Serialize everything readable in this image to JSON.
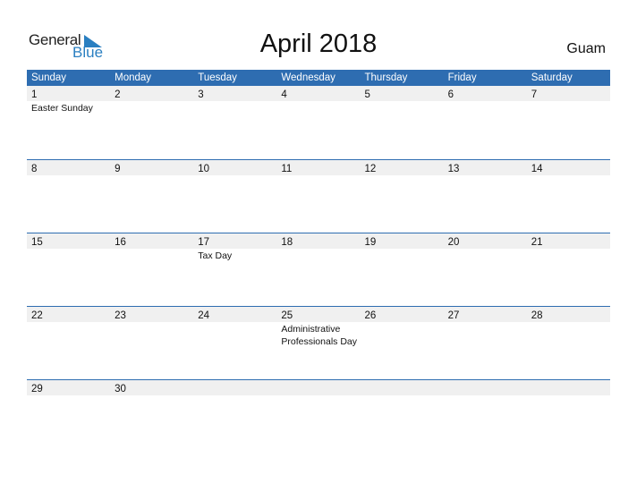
{
  "logo": {
    "general": "General",
    "blue": "Blue",
    "accent": "#2a7fc1"
  },
  "title": "April 2018",
  "country": "Guam",
  "colors": {
    "header_bg": "#2e6db1",
    "band_bg": "#f0f0f0"
  },
  "weekdays": [
    "Sunday",
    "Monday",
    "Tuesday",
    "Wednesday",
    "Thursday",
    "Friday",
    "Saturday"
  ],
  "weeks": [
    {
      "days": [
        {
          "n": "1",
          "ev": "Easter Sunday"
        },
        {
          "n": "2"
        },
        {
          "n": "3"
        },
        {
          "n": "4"
        },
        {
          "n": "5"
        },
        {
          "n": "6"
        },
        {
          "n": "7"
        }
      ]
    },
    {
      "days": [
        {
          "n": "8"
        },
        {
          "n": "9"
        },
        {
          "n": "10"
        },
        {
          "n": "11"
        },
        {
          "n": "12"
        },
        {
          "n": "13"
        },
        {
          "n": "14"
        }
      ]
    },
    {
      "days": [
        {
          "n": "15"
        },
        {
          "n": "16"
        },
        {
          "n": "17",
          "ev": "Tax Day"
        },
        {
          "n": "18"
        },
        {
          "n": "19"
        },
        {
          "n": "20"
        },
        {
          "n": "21"
        }
      ]
    },
    {
      "days": [
        {
          "n": "22"
        },
        {
          "n": "23"
        },
        {
          "n": "24"
        },
        {
          "n": "25",
          "ev": "Administrative\nProfessionals Day"
        },
        {
          "n": "26"
        },
        {
          "n": "27"
        },
        {
          "n": "28"
        }
      ]
    },
    {
      "days": [
        {
          "n": "29"
        },
        {
          "n": "30"
        },
        {
          "n": ""
        },
        {
          "n": ""
        },
        {
          "n": ""
        },
        {
          "n": ""
        },
        {
          "n": ""
        }
      ]
    }
  ]
}
